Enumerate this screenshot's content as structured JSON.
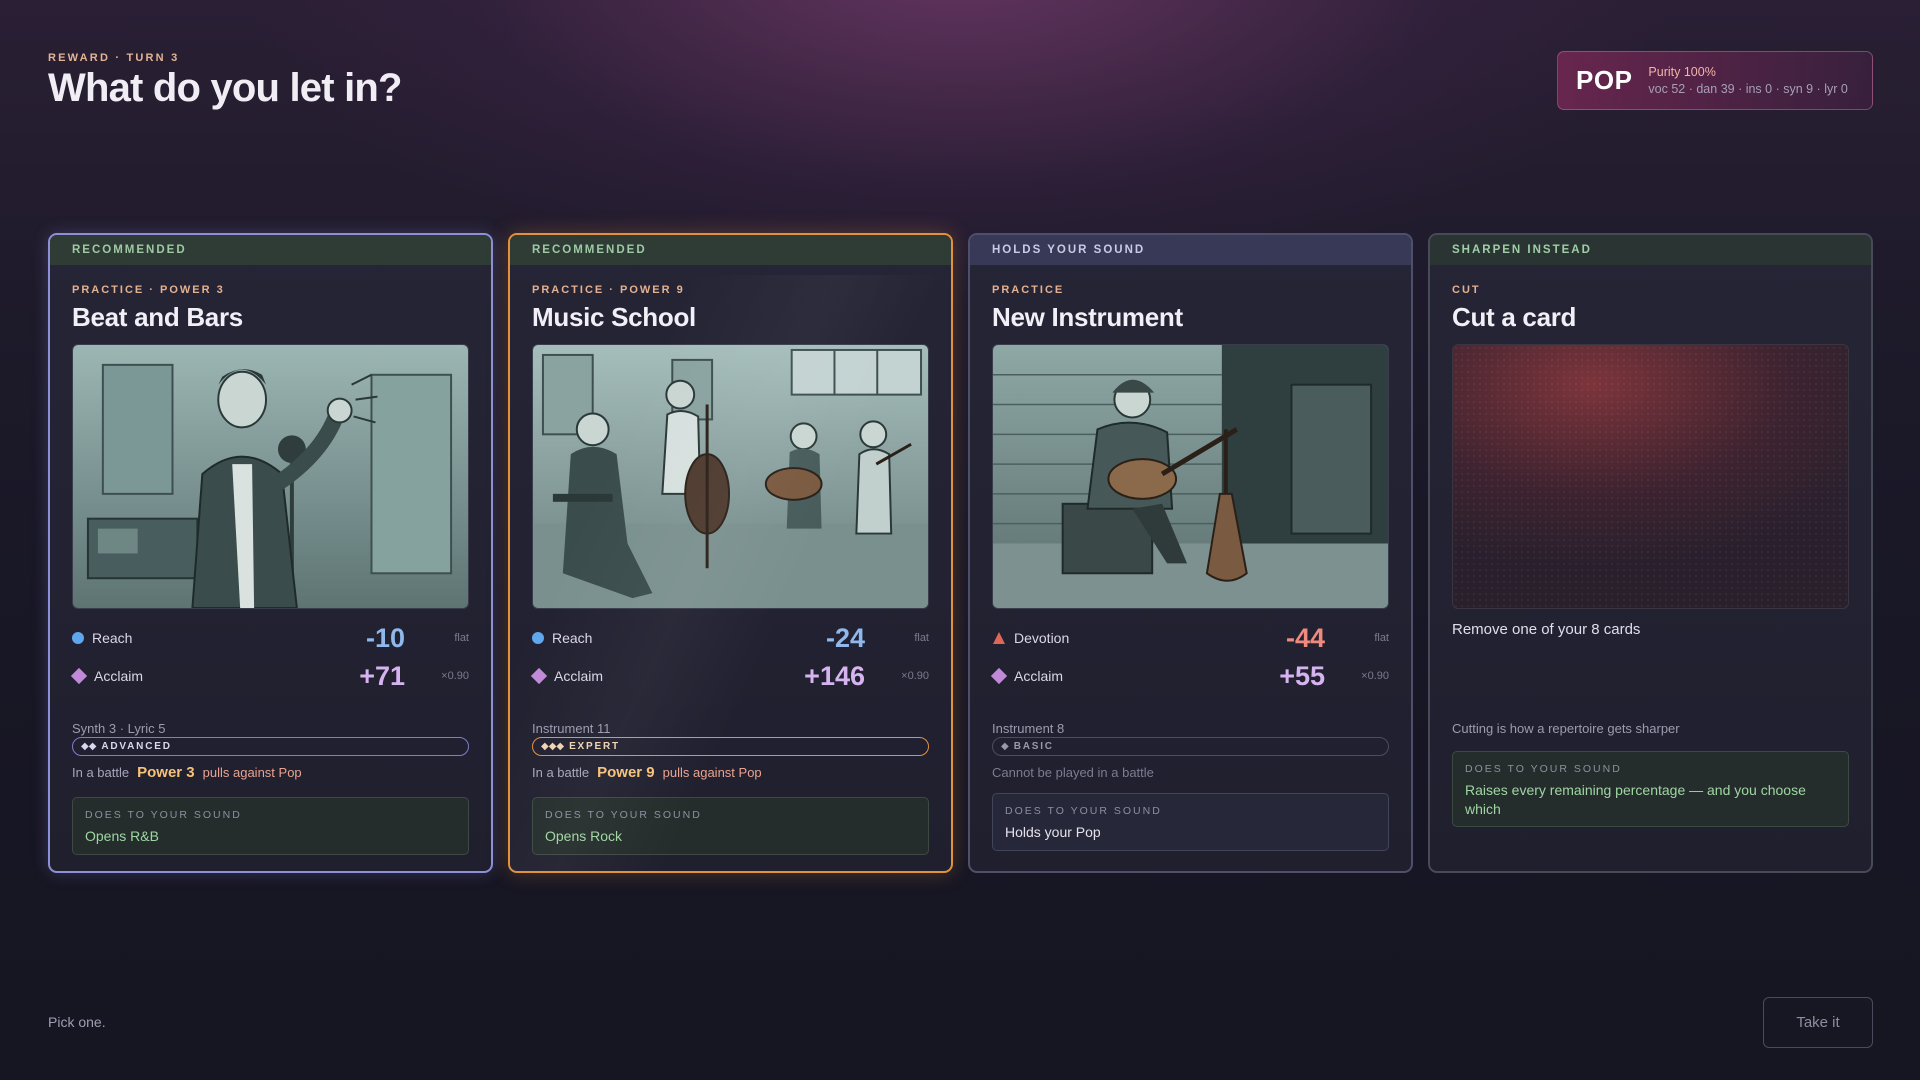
{
  "header": {
    "eyebrow": "REWARD · TURN 3",
    "title": "What do you let in?"
  },
  "genre": {
    "name": "POP",
    "purity": "Purity 100%",
    "stats": "voc 52 · dan 39 · ins 0 · syn 9 · lyr 0"
  },
  "cards": [
    {
      "banner": "RECOMMENDED",
      "kicker": "PRACTICE · POWER 3",
      "title": "Beat and Bars",
      "stats": [
        {
          "label": "Reach",
          "value": "-10",
          "mod": "flat",
          "icon": "dot-blue-icon"
        },
        {
          "label": "Acclaim",
          "value": "+71",
          "mod": "×0.90",
          "icon": "diamond-purple-icon"
        }
      ],
      "requirement": "Synth 3 · Lyric 5",
      "tier_pips": "◆◆",
      "tier": "ADVANCED",
      "battle_prefix": "In a battle",
      "battle_power": "Power 3",
      "battle_suffix": "pulls against Pop",
      "effect_label": "DOES TO YOUR SOUND",
      "effect": "Opens R&B"
    },
    {
      "banner": "RECOMMENDED",
      "kicker": "PRACTICE · POWER 9",
      "title": "Music School",
      "stats": [
        {
          "label": "Reach",
          "value": "-24",
          "mod": "flat",
          "icon": "dot-blue-icon"
        },
        {
          "label": "Acclaim",
          "value": "+146",
          "mod": "×0.90",
          "icon": "diamond-purple-icon"
        }
      ],
      "requirement": "Instrument 11",
      "tier_pips": "◆◆◆",
      "tier": "EXPERT",
      "battle_prefix": "In a battle",
      "battle_power": "Power 9",
      "battle_suffix": "pulls against Pop",
      "effect_label": "DOES TO YOUR SOUND",
      "effect": "Opens Rock"
    },
    {
      "banner": "HOLDS YOUR SOUND",
      "kicker": "PRACTICE",
      "title": "New Instrument",
      "stats": [
        {
          "label": "Devotion",
          "value": "-44",
          "mod": "flat",
          "icon": "triangle-red-icon"
        },
        {
          "label": "Acclaim",
          "value": "+55",
          "mod": "×0.90",
          "icon": "diamond-purple-icon"
        }
      ],
      "requirement": "Instrument 8",
      "tier_pips": "◆",
      "tier": "BASIC",
      "battle_note": "Cannot be played in a battle",
      "effect_label": "DOES TO YOUR SOUND",
      "effect": "Holds your Pop"
    },
    {
      "banner": "SHARPEN INSTEAD",
      "kicker": "CUT",
      "title": "Cut a card",
      "description": "Remove one of your 8 cards",
      "subtext": "Cutting is how a repertoire gets sharper",
      "effect_label": "DOES TO YOUR SOUND",
      "effect": "Raises every remaining percentage — and you choose which"
    }
  ],
  "footer": {
    "hint": "Pick one.",
    "take_label": "Take it"
  },
  "colors": {
    "recommended_border_1": "#8d90d8",
    "recommended_border_2": "#e3913d",
    "reach": "#5fa7ec",
    "acclaim": "#c08ad8",
    "devotion": "#e0665a",
    "effect_green": "#9fd6a3"
  }
}
